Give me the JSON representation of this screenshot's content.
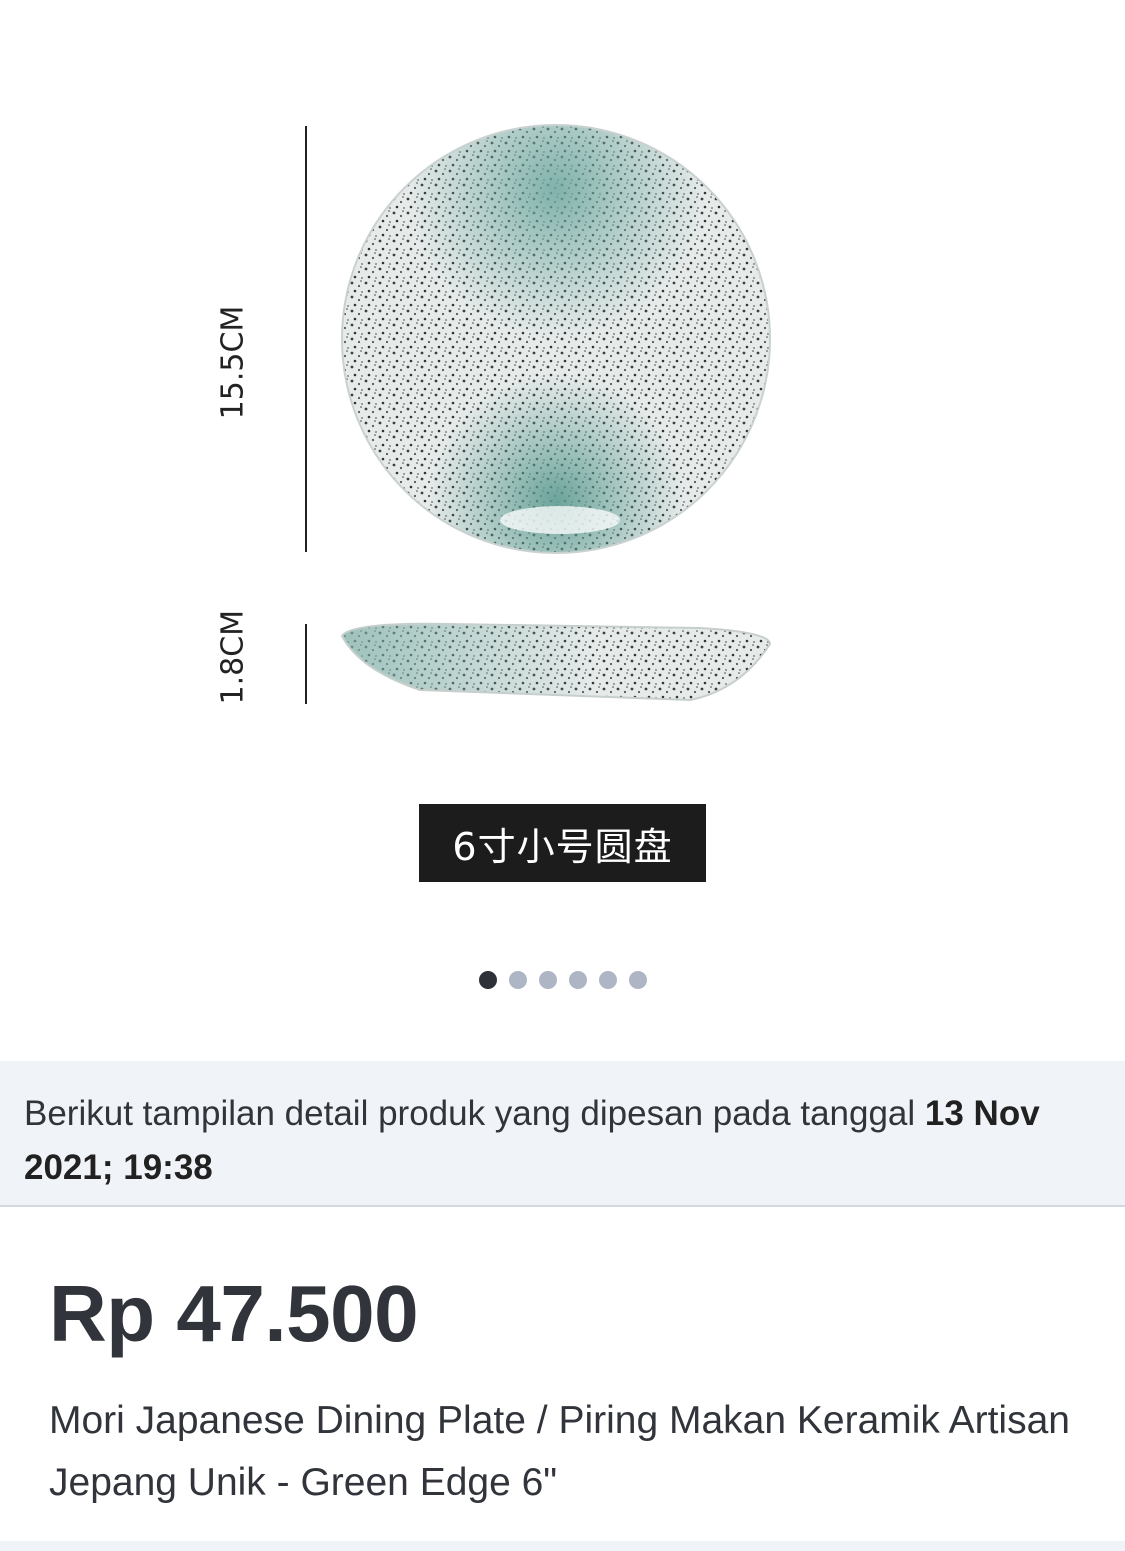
{
  "gallery": {
    "image": {
      "height_label": "15.5CM",
      "depth_label": "1.8CM",
      "caption": "6寸小号圆盘"
    },
    "pagination": {
      "total": 6,
      "active_index": 0,
      "active_color": "#2e3137",
      "inactive_color": "#aeb5c4"
    }
  },
  "order_info": {
    "text": "Berikut tampilan detail produk yang dipesan pada tanggal ",
    "datetime": "13 Nov 2021; 19:38"
  },
  "product": {
    "price": "Rp 47.500",
    "name": "Mori Japanese Dining Plate / Piring Makan Keramik Artisan Jepang Unik - Green Edge 6\""
  },
  "colors": {
    "info_background": "#f0f3f7",
    "text_primary": "#31353b"
  }
}
